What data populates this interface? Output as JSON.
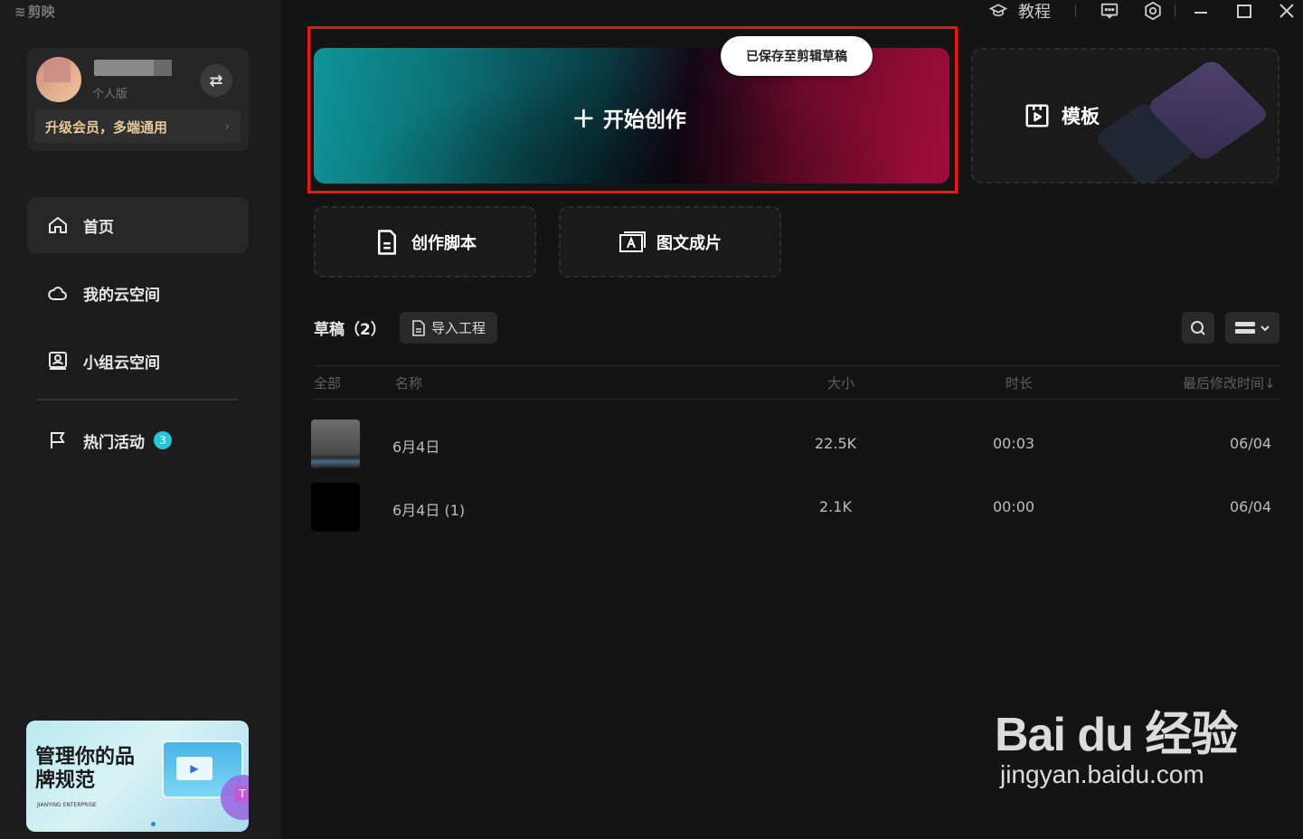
{
  "app": {
    "name": "剪映"
  },
  "titlebar": {
    "tutorial_label": "教程"
  },
  "user": {
    "tag": "个人版",
    "vip_label": "升级会员，多端通用"
  },
  "nav": {
    "items": [
      {
        "label": "首页"
      },
      {
        "label": "我的云空间"
      },
      {
        "label": "小组云空间"
      },
      {
        "label": "热门活动",
        "badge": "3"
      }
    ]
  },
  "promo": {
    "title": "管理你的品牌规范",
    "brand": "JIANYING ENTERPRISE"
  },
  "create": {
    "label": "开始创作",
    "tooltip": "已保存至剪辑草稿"
  },
  "template": {
    "label": "模板"
  },
  "tools": {
    "script_label": "创作脚本",
    "image_text_label": "图文成片"
  },
  "drafts": {
    "title": "草稿（2）",
    "import_label": "导入工程",
    "columns": {
      "all": "全部",
      "name": "名称",
      "size": "大小",
      "duration": "时长",
      "modified": "最后修改时间↓"
    },
    "rows": [
      {
        "name": "6月4日",
        "size": "22.5K",
        "duration": "00:03",
        "modified": "06/04"
      },
      {
        "name": "6月4日 (1)",
        "size": "2.1K",
        "duration": "00:00",
        "modified": "06/04"
      }
    ]
  },
  "watermark": {
    "brand": "Bai du 经验",
    "url": "jingyan.baidu.com"
  }
}
